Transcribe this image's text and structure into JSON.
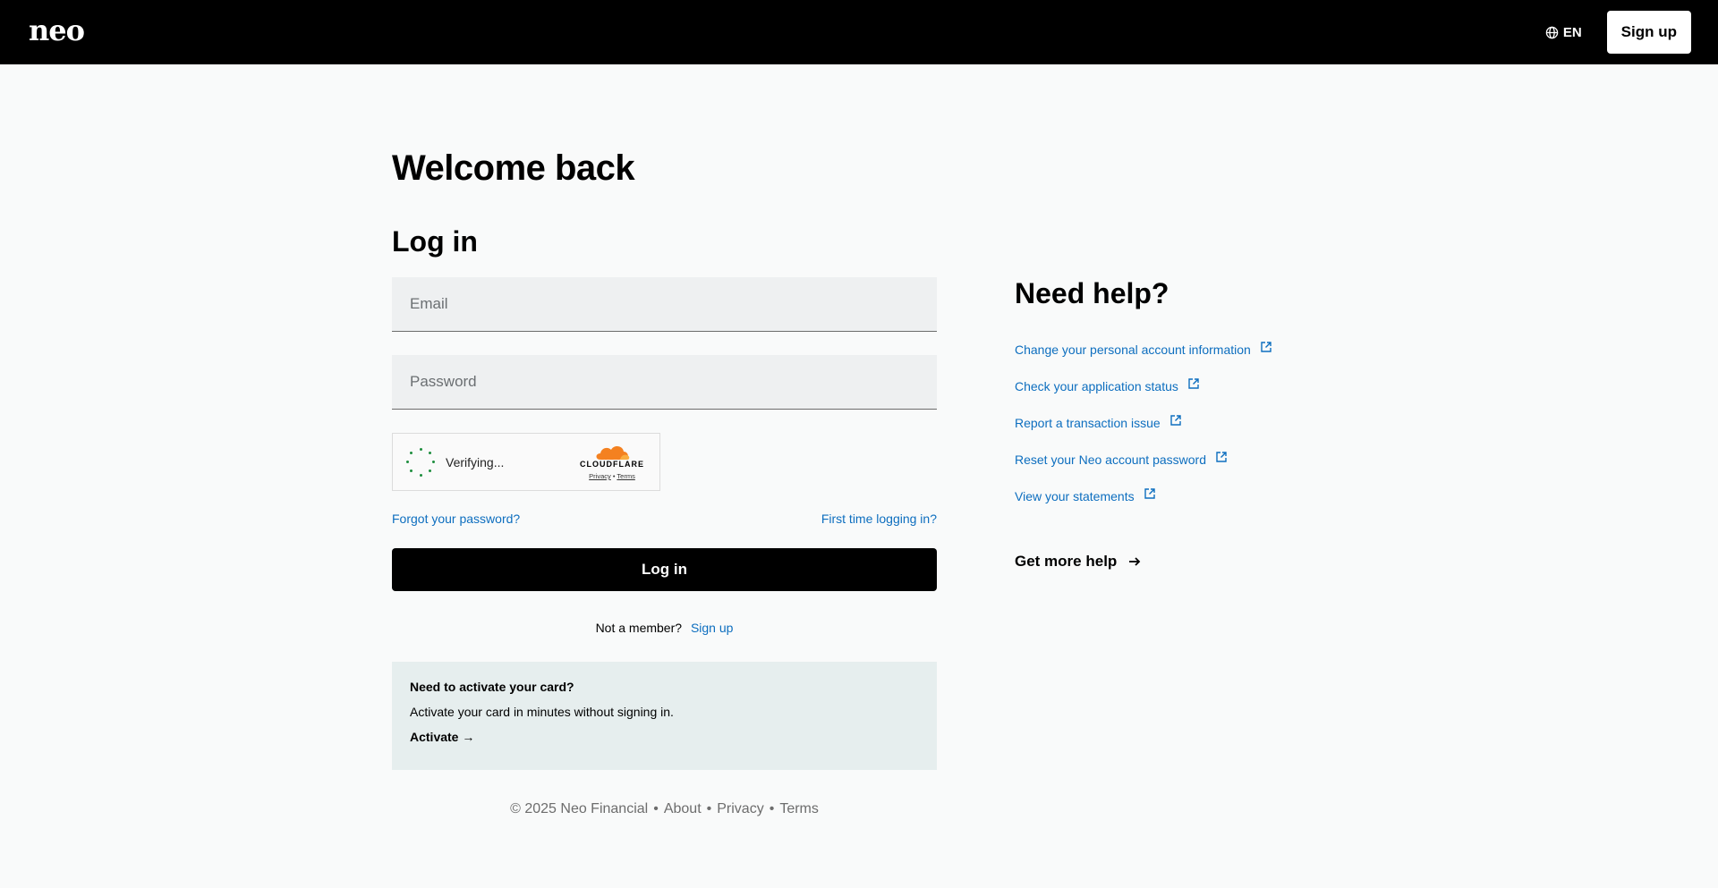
{
  "header": {
    "logo": "neo",
    "language": "EN",
    "signup_label": "Sign up"
  },
  "login": {
    "welcome": "Welcome back",
    "title": "Log in",
    "email_placeholder": "Email",
    "password_placeholder": "Password",
    "captcha": {
      "status": "Verifying...",
      "brand": "CLOUDFLARE",
      "privacy": "Privacy",
      "terms": "Terms"
    },
    "forgot_password": "Forgot your password?",
    "first_time": "First time logging in?",
    "login_button": "Log in",
    "not_member": "Not a member?",
    "signup_link": "Sign up"
  },
  "activate": {
    "title": "Need to activate your card?",
    "text": "Activate your card in minutes without signing in.",
    "link": "Activate →"
  },
  "footer": {
    "copyright": "© 2025 Neo Financial",
    "about": "About",
    "privacy": "Privacy",
    "terms": "Terms",
    "separator": "•"
  },
  "help": {
    "title": "Need help?",
    "items": [
      {
        "label": "Change your personal account information"
      },
      {
        "label": "Check your application status"
      },
      {
        "label": "Report a transaction issue"
      },
      {
        "label": "Reset your Neo account password"
      },
      {
        "label": "View your statements"
      }
    ],
    "more": "Get more help"
  },
  "colors": {
    "link": "#0d6ebf",
    "header_bg": "#000000",
    "activate_bg": "#e6eeee"
  }
}
